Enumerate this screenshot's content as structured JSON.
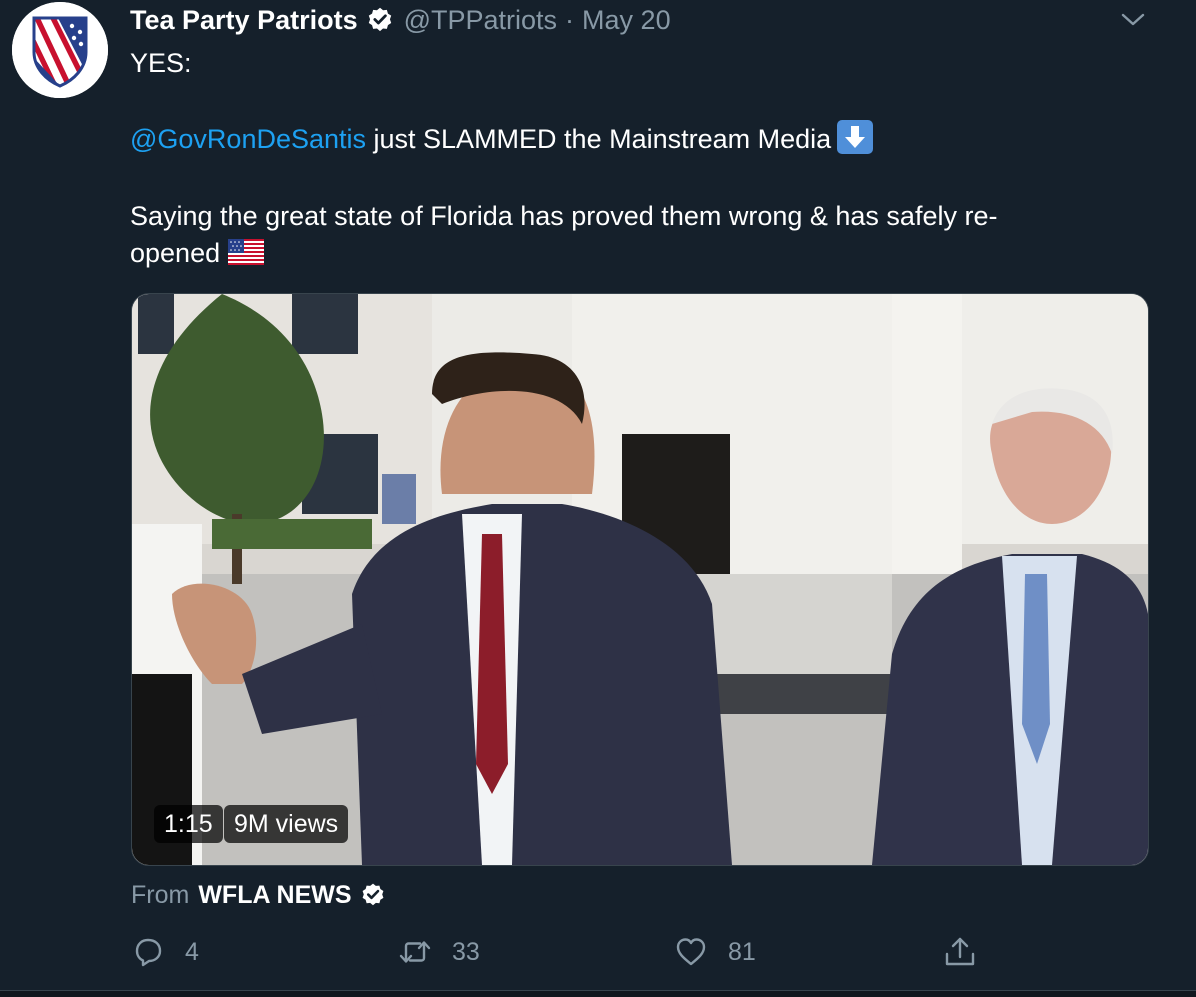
{
  "tweet": {
    "display_name": "Tea Party Patriots",
    "handle": "@TPPatriots",
    "separator": "·",
    "date": "May 20",
    "verified": true,
    "text_line_1": "YES:",
    "mention": "@GovRonDeSantis",
    "text_line_2_rest": " just SLAMMED the Mainstream Media",
    "text_line_3": "Saying the great state of Florida has proved them wrong & has safely re-",
    "text_line_4": "opened",
    "emoji_1": "down-arrow-emoji",
    "emoji_2": "us-flag-emoji"
  },
  "media": {
    "type": "video",
    "duration": "1:15",
    "views": "9M views"
  },
  "source": {
    "from_label": "From",
    "name": "WFLA NEWS",
    "verified": true
  },
  "actions": {
    "reply_count": "4",
    "retweet_count": "33",
    "like_count": "81"
  },
  "colors": {
    "background": "#15202b",
    "secondary_text": "#8899a6",
    "link": "#1da1f2",
    "verified_badge": "#ffffff"
  }
}
